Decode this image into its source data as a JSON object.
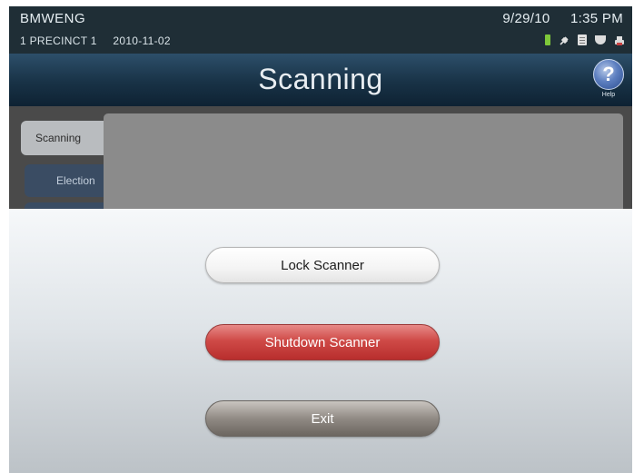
{
  "status_bar": {
    "operator": "BMWENG",
    "precinct": "1 PRECINCT 1",
    "election_date": "2010-11-02",
    "date": "9/29/10",
    "time": "1:35 PM",
    "icons": [
      "battery-icon",
      "power-plug-icon",
      "document-icon",
      "ballot-box-icon",
      "printer-icon"
    ],
    "battery_color": "#7ec83a"
  },
  "header": {
    "title": "Scanning",
    "help_symbol": "?",
    "help_label": "Help"
  },
  "tabs": [
    {
      "label": "Scanning"
    },
    {
      "label": "Election"
    }
  ],
  "dialog": {
    "lock_label": "Lock Scanner",
    "shutdown_label": "Shutdown Scanner",
    "exit_label": "Exit",
    "shutdown_color": "#cf4a47"
  }
}
